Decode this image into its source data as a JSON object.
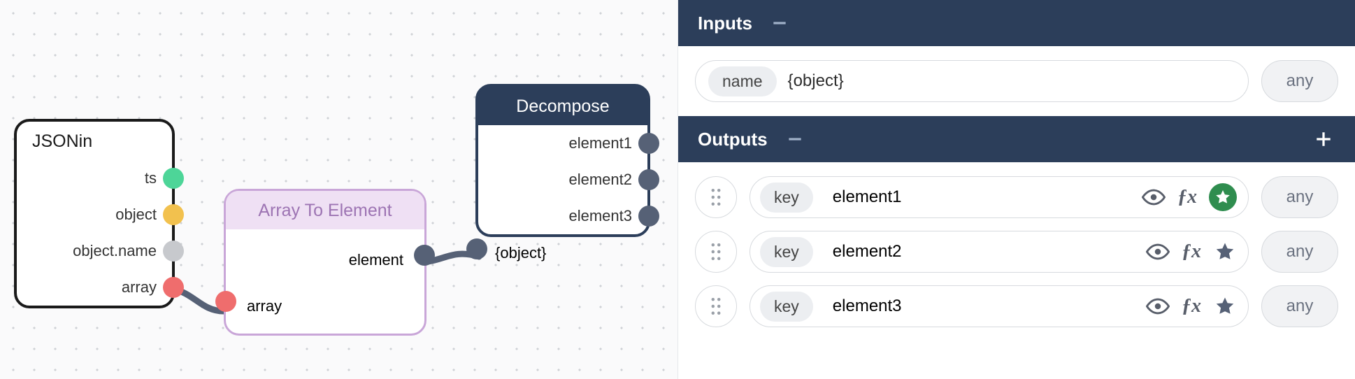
{
  "canvas": {
    "jsonin": {
      "title": "JSONin",
      "ports": [
        {
          "label": "ts",
          "color": "green"
        },
        {
          "label": "object",
          "color": "yellow"
        },
        {
          "label": "object.name",
          "color": "grey"
        },
        {
          "label": "array",
          "color": "red"
        }
      ]
    },
    "array_to_element": {
      "title": "Array To Element",
      "in_label": "array",
      "out_label": "element"
    },
    "decompose": {
      "title": "Decompose",
      "in_label": "{object}",
      "outs": [
        "element1",
        "element2",
        "element3"
      ]
    }
  },
  "panel": {
    "inputs_title": "Inputs",
    "outputs_title": "Outputs",
    "name_tag": "name",
    "key_tag": "key",
    "any_tag": "any",
    "input": {
      "value": "{object}",
      "type": "any"
    },
    "outputs": [
      {
        "value": "element1",
        "type": "any",
        "featured": true
      },
      {
        "value": "element2",
        "type": "any",
        "featured": false
      },
      {
        "value": "element3",
        "type": "any",
        "featured": false
      }
    ]
  }
}
